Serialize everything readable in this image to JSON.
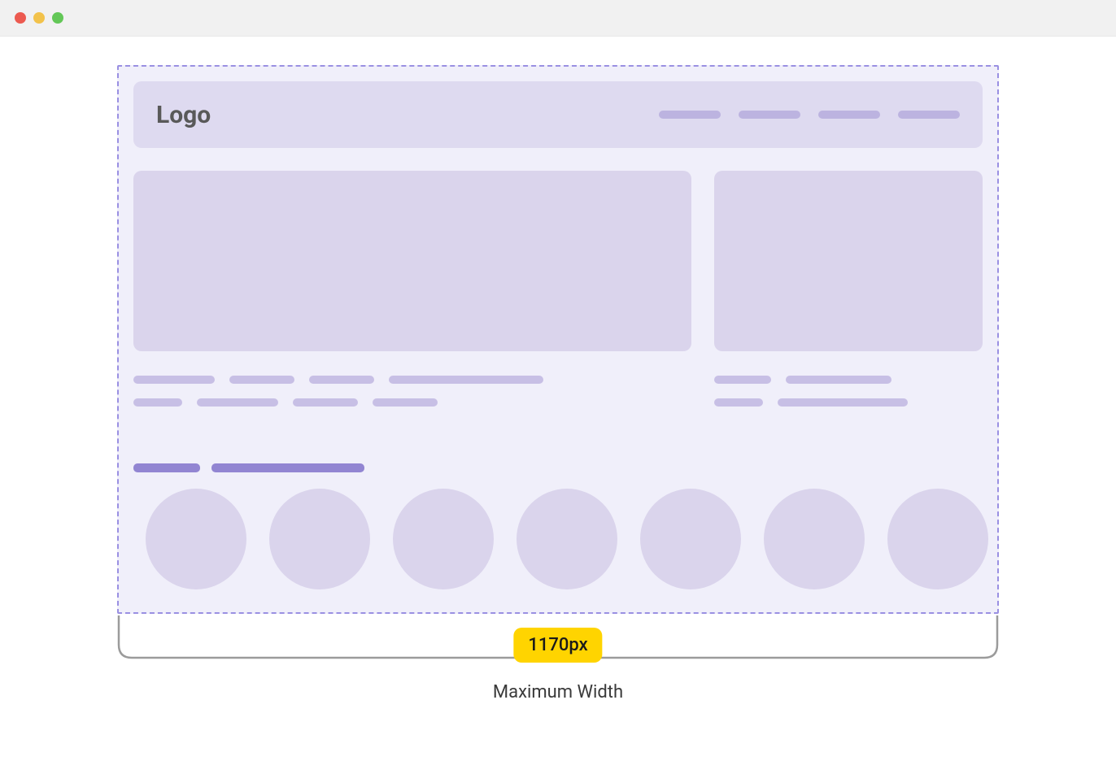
{
  "window": {
    "traffic_lights": [
      "red",
      "yellow",
      "green"
    ]
  },
  "wireframe": {
    "logo_text": "Logo",
    "nav_item_count": 4,
    "circle_count": 7
  },
  "measurement": {
    "width_value": "1170px",
    "label": "Maximum Width"
  },
  "colors": {
    "canvas_bg": "#f0effa",
    "dashed_border": "#9a90e2",
    "block_fill": "#dad4ec",
    "header_fill": "#dedaf0",
    "nav_placeholder": "#bcb3e0",
    "text_placeholder": "#c7bfe5",
    "heading_placeholder": "#9285d2",
    "badge_bg": "#ffd400"
  }
}
